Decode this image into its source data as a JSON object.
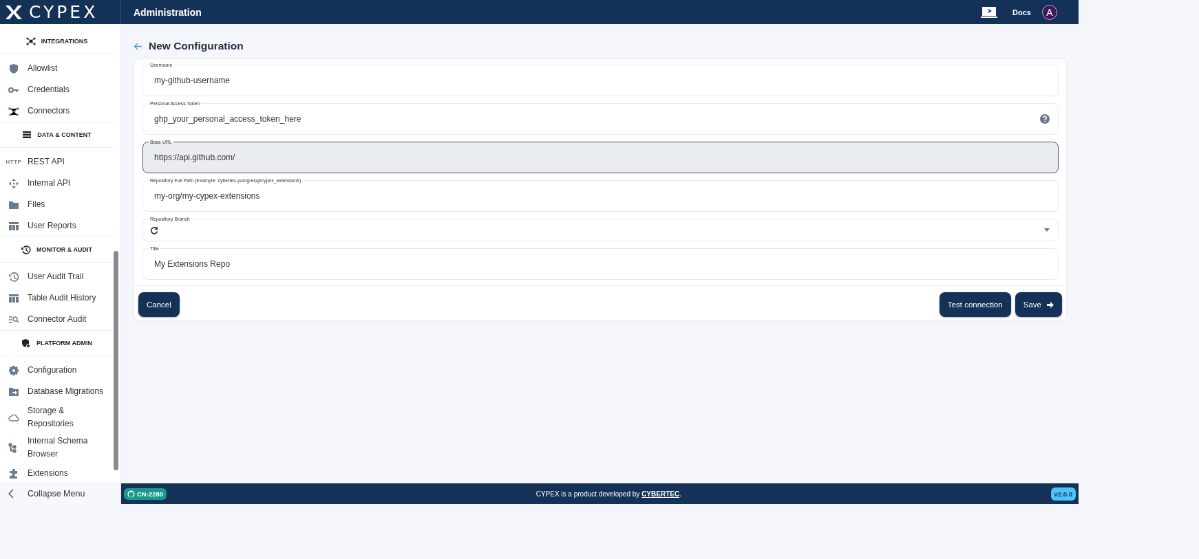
{
  "header": {
    "logo": "CYPEX",
    "title": "Administration",
    "docs": "Docs",
    "avatar": "A"
  },
  "sidebar": {
    "sections": [
      {
        "title": "INTEGRATIONS",
        "items": [
          {
            "label": "Allowlist"
          },
          {
            "label": "Credentials"
          },
          {
            "label": "Connectors"
          }
        ]
      },
      {
        "title": "DATA & CONTENT",
        "items": [
          {
            "label": "REST API",
            "icon_text": "HTTP"
          },
          {
            "label": "Internal API"
          },
          {
            "label": "Files"
          },
          {
            "label": "User Reports"
          }
        ]
      },
      {
        "title": "MONITOR & AUDIT",
        "items": [
          {
            "label": "User Audit Trail"
          },
          {
            "label": "Table Audit History"
          },
          {
            "label": "Connector Audit"
          }
        ]
      },
      {
        "title": "PLATFORM ADMIN",
        "items": [
          {
            "label": "Configuration"
          },
          {
            "label": "Database Migrations"
          },
          {
            "label": "Storage & Repositories"
          },
          {
            "label": "Internal Schema Browser"
          },
          {
            "label": "Extensions"
          }
        ]
      }
    ],
    "collapse": "Collapse Menu"
  },
  "page": {
    "title": "New Configuration",
    "fields": [
      {
        "kind": "text",
        "label": "Username",
        "value": "my-github-username",
        "focused": false
      },
      {
        "kind": "help",
        "label": "Personal Access Token",
        "value": "ghp_your_personal_access_token_here",
        "focused": false
      },
      {
        "kind": "text",
        "label": "Base URL",
        "value": "https://api.github.com/",
        "focused": true
      },
      {
        "kind": "text",
        "label": "Repository Full Path (Example: cybertec-postgresql/cypex_extensions)",
        "value": "my-org/my-cypex-extensions",
        "focused": false
      },
      {
        "kind": "select",
        "label": "Repository Branch",
        "focused": false
      },
      {
        "kind": "text",
        "label": "Title",
        "value": "My Extensions Repo",
        "focused": false
      }
    ],
    "buttons": {
      "cancel": "Cancel",
      "test": "Test connection",
      "save": "Save"
    }
  },
  "footer": {
    "badge": "CN-2280",
    "text": "CYPEX is a product developed by ",
    "link": "CYBERTEC",
    "after": ".",
    "version": "v2.0.0"
  }
}
